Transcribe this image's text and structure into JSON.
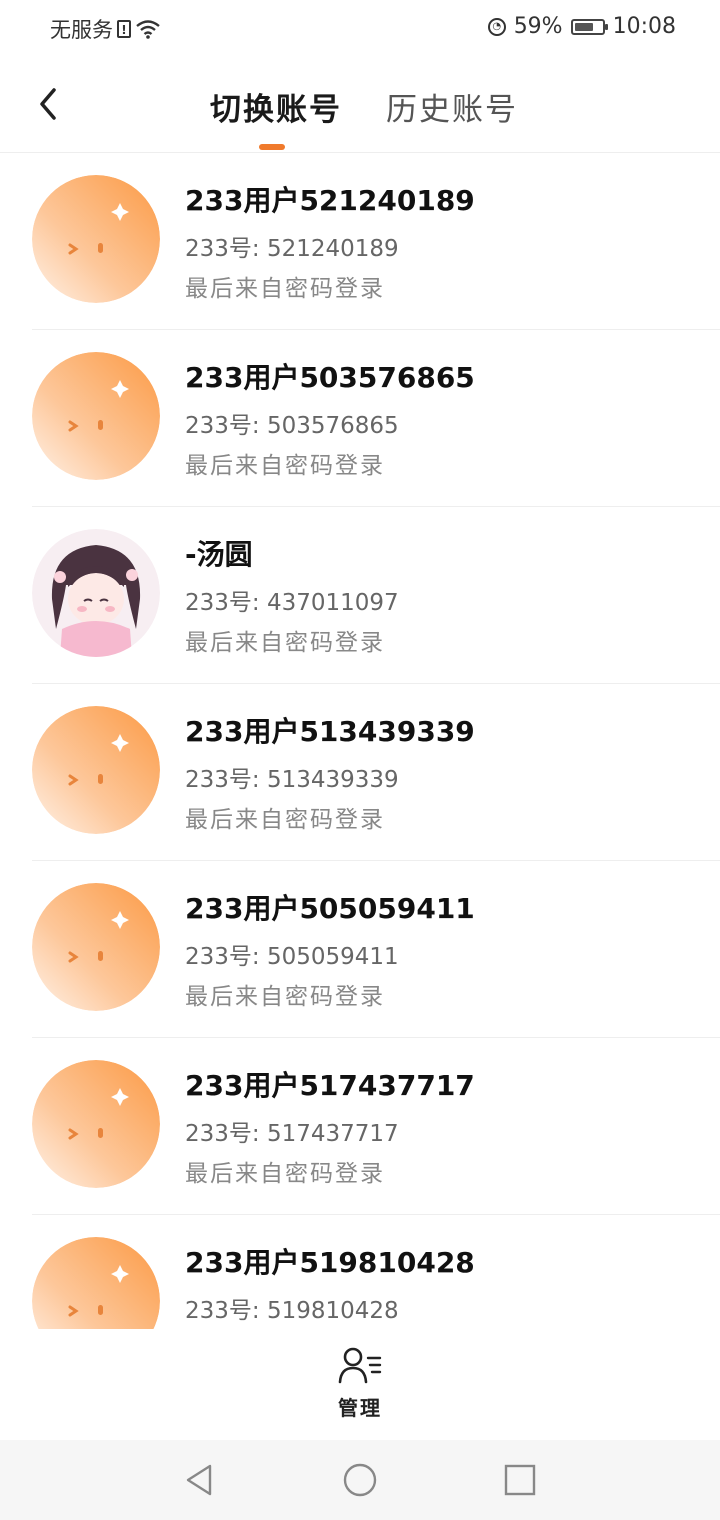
{
  "status_bar": {
    "carrier": "无服务",
    "sim_icon": "sim-alert-icon",
    "wifi_icon": "wifi-icon",
    "alarm_icon": "alarm-icon",
    "battery": "59%",
    "time": "10:08"
  },
  "header": {
    "back_icon": "back-chevron-icon",
    "tabs": [
      {
        "label": "切换账号",
        "active": true
      },
      {
        "label": "历史账号",
        "active": false
      }
    ],
    "accent_color": "#f07a2c"
  },
  "accounts": [
    {
      "name": "233用户521240189",
      "number": "233号: 521240189",
      "login": "最后来自密码登录",
      "avatar": "default-orange-avatar"
    },
    {
      "name": "233用户503576865",
      "number": "233号: 503576865",
      "login": "最后来自密码登录",
      "avatar": "default-orange-avatar"
    },
    {
      "name": "-汤圆",
      "number": "233号: 437011097",
      "login": "最后来自密码登录",
      "avatar": "anime-girl-avatar"
    },
    {
      "name": "233用户513439339",
      "number": "233号: 513439339",
      "login": "最后来自密码登录",
      "avatar": "default-orange-avatar"
    },
    {
      "name": "233用户505059411",
      "number": "233号: 505059411",
      "login": "最后来自密码登录",
      "avatar": "default-orange-avatar"
    },
    {
      "name": "233用户517437717",
      "number": "233号: 517437717",
      "login": "最后来自密码登录",
      "avatar": "default-orange-avatar"
    },
    {
      "name": "233用户519810428",
      "number": "233号: 519810428",
      "login": "",
      "avatar": "default-orange-avatar"
    }
  ],
  "manage": {
    "label": "管理",
    "icon": "manage-users-icon"
  },
  "nav_bar": {
    "back_icon": "nav-back-triangle-icon",
    "home_icon": "nav-home-circle-icon",
    "recent_icon": "nav-recent-square-icon"
  }
}
